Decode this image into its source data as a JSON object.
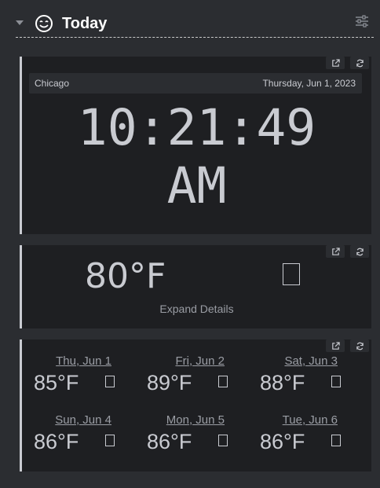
{
  "section": {
    "title": "Today"
  },
  "clock": {
    "city": "Chicago",
    "date": "Thursday, Jun 1, 2023",
    "time": "10:21:49",
    "ampm": "AM"
  },
  "current_weather": {
    "temperature": "80°F",
    "expand_label": "Expand Details"
  },
  "forecast": [
    {
      "day": "Thu, Jun 1",
      "temp": "85°F"
    },
    {
      "day": "Fri, Jun 2",
      "temp": "89°F"
    },
    {
      "day": "Sat, Jun 3",
      "temp": "88°F"
    },
    {
      "day": "Sun, Jun 4",
      "temp": "86°F"
    },
    {
      "day": "Mon, Jun 5",
      "temp": "86°F"
    },
    {
      "day": "Tue, Jun 6",
      "temp": "86°F"
    }
  ],
  "icons": {
    "collapse": "chevron-down-icon",
    "section": "smile-icon",
    "settings": "sliders-icon",
    "open": "external-link-icon",
    "refresh": "refresh-icon"
  },
  "colors": {
    "background": "#2b2d31",
    "card": "#1e1f22",
    "text": "#c9cbd1",
    "muted": "#9a9da4",
    "title": "#ffffff"
  }
}
